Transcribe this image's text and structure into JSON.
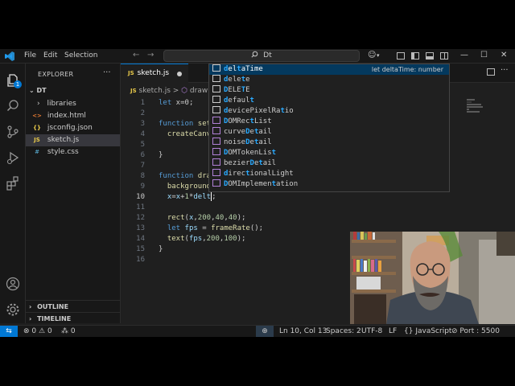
{
  "menu": [
    "File",
    "Edit",
    "Selection"
  ],
  "search": {
    "text": "Dt"
  },
  "activity_badge": "1",
  "sidebar": {
    "title": "EXPLORER",
    "more": "···",
    "folder": "DT",
    "items": [
      {
        "label": "libraries",
        "icon": "›",
        "kind": "folder"
      },
      {
        "label": "index.html",
        "icon": "<>",
        "kind": "html"
      },
      {
        "label": "jsconfig.json",
        "icon": "{}",
        "kind": "json"
      },
      {
        "label": "sketch.js",
        "icon": "JS",
        "kind": "js"
      },
      {
        "label": "style.css",
        "icon": "#",
        "kind": "css"
      }
    ],
    "outline": "OUTLINE",
    "timeline": "TIMELINE"
  },
  "tab": {
    "icon": "JS",
    "label": "sketch.js"
  },
  "breadcrumb": {
    "file": "sketch.js",
    "sep": ">",
    "symbol": "draw"
  },
  "code": {
    "line_numbers": [
      "1",
      "2",
      "3",
      "4",
      "5",
      "6",
      "7",
      "8",
      "9",
      "10",
      "11",
      "12",
      "13",
      "14",
      "15",
      "16"
    ],
    "current_line": "10"
  },
  "suggest": {
    "items": [
      {
        "pre": "",
        "hl1": "d",
        "mid": "el",
        "hl2": "t",
        "post": "aTime",
        "type": "var"
      },
      {
        "pre": "",
        "hl1": "d",
        "mid": "ele",
        "hl2": "t",
        "post": "e",
        "type": "kw"
      },
      {
        "pre": "",
        "hl1": "D",
        "mid": "ELE",
        "hl2": "T",
        "post": "E",
        "type": "var"
      },
      {
        "pre": "",
        "hl1": "d",
        "mid": "efaul",
        "hl2": "t",
        "post": "",
        "type": "kw"
      },
      {
        "pre": "",
        "hl1": "d",
        "mid": "evicePixelRa",
        "hl2": "t",
        "post": "io",
        "type": "var"
      },
      {
        "pre": "",
        "hl1": "D",
        "mid": "OMRec",
        "hl2": "t",
        "post": "List",
        "type": "cube"
      },
      {
        "pre": "curve",
        "hl1": "D",
        "mid": "e",
        "hl2": "t",
        "post": "ail",
        "type": "cube"
      },
      {
        "pre": "noise",
        "hl1": "D",
        "mid": "e",
        "hl2": "t",
        "post": "ail",
        "type": "cube"
      },
      {
        "pre": "",
        "hl1": "D",
        "mid": "OMTokenLis",
        "hl2": "t",
        "post": "",
        "type": "cube"
      },
      {
        "pre": "bezier",
        "hl1": "D",
        "mid": "e",
        "hl2": "t",
        "post": "ail",
        "type": "cube"
      },
      {
        "pre": "",
        "hl1": "d",
        "mid": "irec",
        "hl2": "t",
        "post": "ionalLight",
        "type": "cube"
      },
      {
        "pre": "",
        "hl1": "D",
        "mid": "OMImplemen",
        "hl2": "t",
        "post": "ation",
        "type": "cube"
      }
    ],
    "detail": "let deltaTime: number"
  },
  "status": {
    "problems_errors": "0",
    "problems_warnings": "0",
    "ports": "0",
    "position": "Ln 10, Col 13",
    "spaces": "Spaces: 2",
    "encoding": "UTF-8",
    "eol": "LF",
    "language": "JavaScript",
    "port": "Port : 5500"
  }
}
